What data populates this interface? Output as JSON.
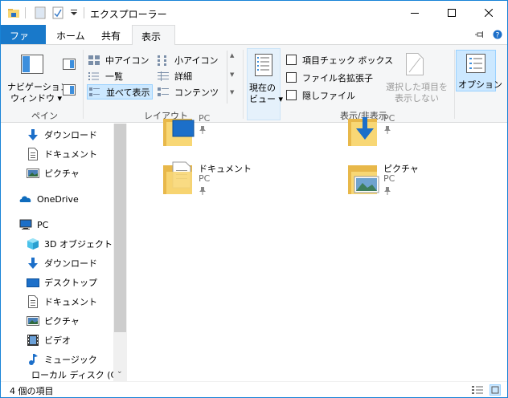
{
  "window": {
    "title": "エクスプローラー",
    "accent": "#1979ca"
  },
  "titlebar": {
    "minimize_icon": "minimize-icon",
    "maximize_icon": "maximize-icon",
    "close_icon": "close-icon"
  },
  "tabs": {
    "file": "ファイル",
    "home": "ホーム",
    "share": "共有",
    "view": "表示"
  },
  "ribbon": {
    "pane_group": {
      "label": "ペイン",
      "nav_pane_line1": "ナビゲーション",
      "nav_pane_line2": "ウィンドウ"
    },
    "layout_group": {
      "label": "レイアウト",
      "medium_icons": "中アイコン",
      "small_icons": "小アイコン",
      "list": "一覧",
      "details": "詳細",
      "tiles": "並べて表示",
      "content": "コンテンツ"
    },
    "current_view": {
      "line1": "現在の",
      "line2": "ビュー"
    },
    "show_hide_group": {
      "label": "表示/非表示",
      "item_checkboxes": "項目チェック ボックス",
      "file_ext": "ファイル名拡張子",
      "hidden_items": "隠しファイル",
      "hide_selected_line1": "選択した項目を",
      "hide_selected_line2": "表示しない"
    },
    "options": "オプション"
  },
  "nav": {
    "quick": [
      {
        "label": "ダウンロード",
        "icon": "download-icon"
      },
      {
        "label": "ドキュメント",
        "icon": "document-icon"
      },
      {
        "label": "ピクチャ",
        "icon": "pictures-icon"
      }
    ],
    "onedrive": "OneDrive",
    "pc": "PC",
    "pc_items": [
      {
        "label": "3D オブジェクト",
        "icon": "3d-objects-icon"
      },
      {
        "label": "ダウンロード",
        "icon": "download-icon"
      },
      {
        "label": "デスクトップ",
        "icon": "desktop-icon"
      },
      {
        "label": "ドキュメント",
        "icon": "document-icon"
      },
      {
        "label": "ピクチャ",
        "icon": "pictures-icon"
      },
      {
        "label": "ビデオ",
        "icon": "video-icon"
      },
      {
        "label": "ミュージック",
        "icon": "music-icon"
      },
      {
        "label": "ローカル ディスク (C",
        "icon": "disk-icon"
      }
    ]
  },
  "content": {
    "tiles": [
      {
        "name": "",
        "sub": "PC"
      },
      {
        "name": "",
        "sub": "PC"
      },
      {
        "name": "ドキュメント",
        "sub": "PC"
      },
      {
        "name": "ピクチャ",
        "sub": "PC"
      }
    ]
  },
  "status": {
    "count": "4 個の項目"
  }
}
